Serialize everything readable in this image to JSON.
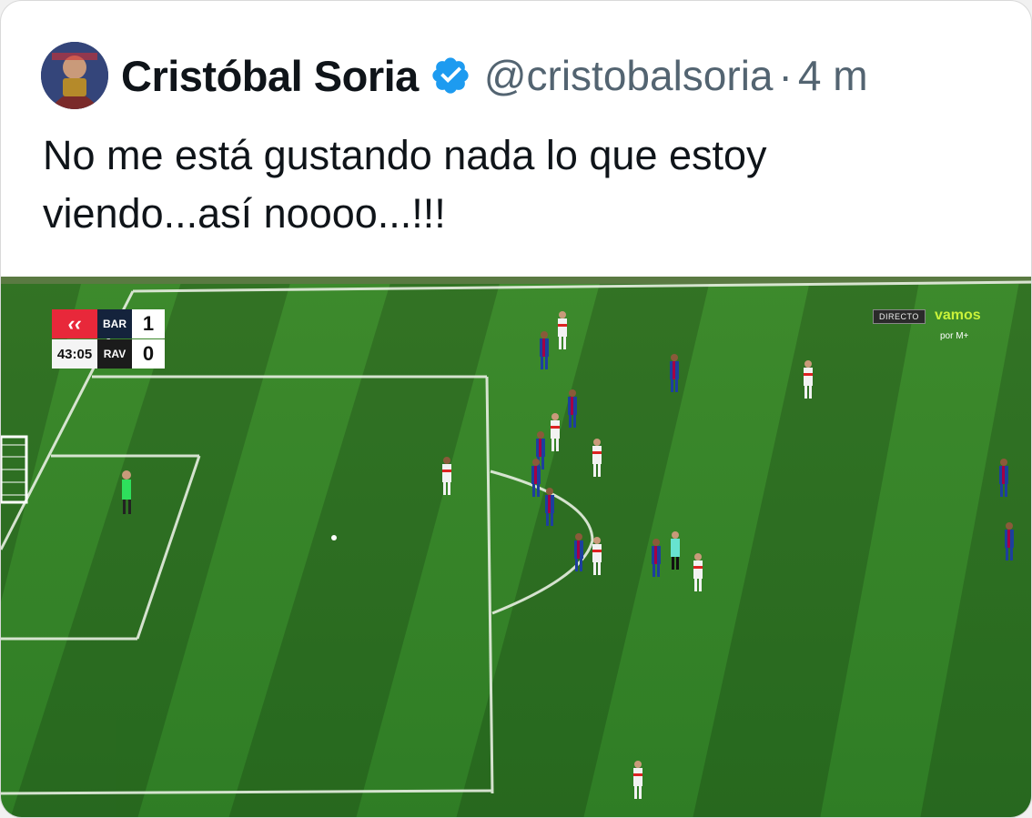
{
  "tweet": {
    "author_name": "Cristóbal Soria",
    "handle": "@cristobalsoria",
    "separator": "·",
    "time": "4 m",
    "text": "No me está gustando nada lo que estoy\nviendo...así noooo...!!!",
    "verified_icon": "verified-badge-icon",
    "accent_color": "#1d9bf0"
  },
  "broadcast": {
    "scoreboard": {
      "league_logo_text": "‹‹",
      "clock": "43:05",
      "home_team": "BAR",
      "home_score": "1",
      "away_team": "RAV",
      "away_score": "0"
    },
    "live_label": "DIRECTO",
    "channel_logo": "vamos",
    "provider_label": "por M+"
  }
}
